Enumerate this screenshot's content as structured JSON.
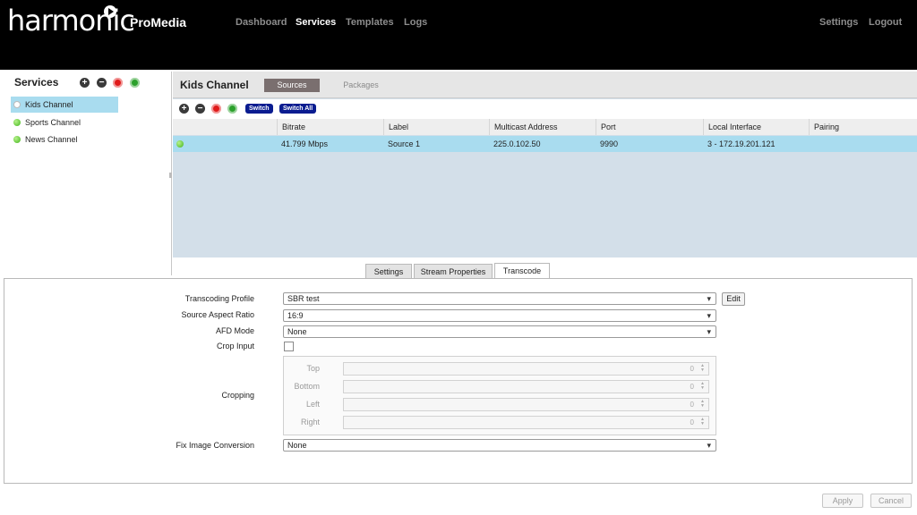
{
  "brand": {
    "logo": "harmonic",
    "product": "ProMedia"
  },
  "nav": {
    "dashboard": "Dashboard",
    "services": "Services",
    "templates": "Templates",
    "logs": "Logs",
    "settings": "Settings",
    "logout": "Logout"
  },
  "sidebar": {
    "title": "Services",
    "items": [
      {
        "label": "Kids Channel",
        "status": "white",
        "selected": true
      },
      {
        "label": "Sports Channel",
        "status": "green"
      },
      {
        "label": "News Channel",
        "status": "green"
      }
    ]
  },
  "channel": {
    "title": "Kids Channel",
    "tab_sources": "Sources",
    "tab_packages": "Packages"
  },
  "toolbar": {
    "switch": "Switch",
    "switch_all": "Switch All"
  },
  "table": {
    "columns": [
      "Bitrate",
      "Label",
      "Multicast Address",
      "Port",
      "Local Interface",
      "Pairing"
    ],
    "rows": [
      {
        "status": "green",
        "bitrate": "41.799 Mbps",
        "label": "Source 1",
        "multicast": "225.0.102.50",
        "port": "9990",
        "local_interface": "3 - 172.19.201.121",
        "pairing": ""
      }
    ]
  },
  "subtabs": {
    "settings": "Settings",
    "stream_properties": "Stream Properties",
    "transcode": "Transcode"
  },
  "form": {
    "transcoding_profile_label": "Transcoding Profile",
    "transcoding_profile_value": "SBR test",
    "edit": "Edit",
    "source_aspect_ratio_label": "Source Aspect Ratio",
    "source_aspect_ratio_value": "16:9",
    "afd_mode_label": "AFD Mode",
    "afd_mode_value": "None",
    "crop_input_label": "Crop Input",
    "cropping_label": "Cropping",
    "crop": {
      "top": "Top",
      "bottom": "Bottom",
      "left": "Left",
      "right": "Right",
      "top_value": "0",
      "bottom_value": "0",
      "left_value": "0",
      "right_value": "0"
    },
    "fix_image_conversion_label": "Fix Image Conversion",
    "fix_image_conversion_value": "None"
  },
  "footer": {
    "apply": "Apply",
    "cancel": "Cancel"
  },
  "colors": {
    "selection": "#a9dcef",
    "pill": "#0a1c90",
    "red": "#e01b1b",
    "green": "#2ca02c"
  }
}
